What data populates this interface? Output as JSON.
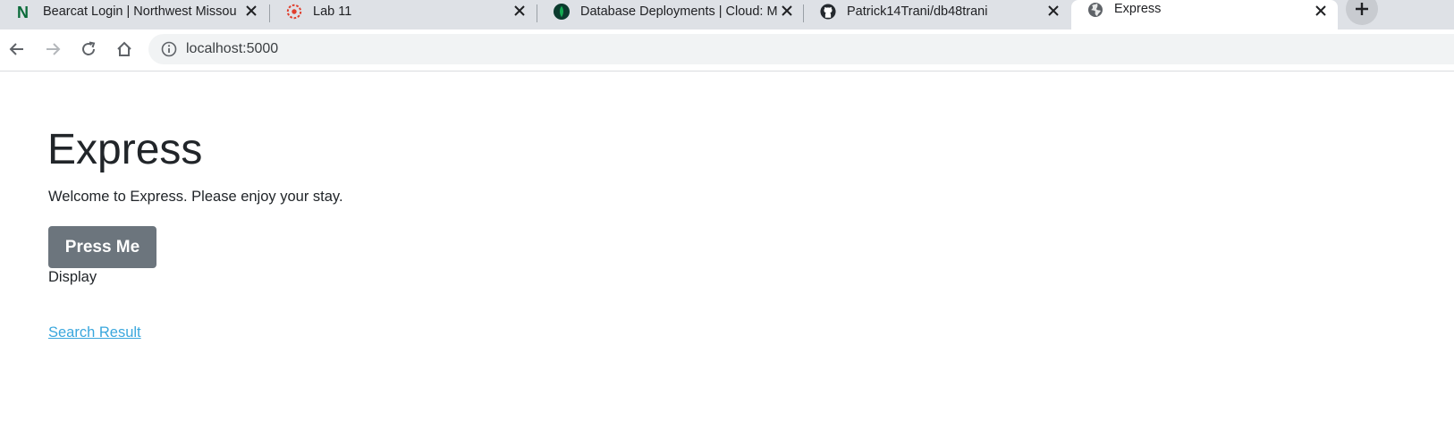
{
  "tabs": [
    {
      "title": "Bearcat Login | Northwest Missou",
      "icon": "northwest-n-icon"
    },
    {
      "title": "Lab 11",
      "icon": "canvas-icon"
    },
    {
      "title": "Database Deployments | Cloud: M",
      "icon": "mongodb-leaf-icon"
    },
    {
      "title": "Patrick14Trani/db48trani",
      "icon": "github-icon"
    },
    {
      "title": "Express",
      "icon": "globe-icon",
      "active": true
    }
  ],
  "address_bar": {
    "url": "localhost:5000"
  },
  "page": {
    "heading": "Express",
    "welcome": "Welcome to Express. Please enjoy your stay.",
    "button_label": "Press Me",
    "display_text": "Display",
    "link_text": "Search Result"
  },
  "colors": {
    "button_bg": "#6c757d",
    "link": "#3aa7dd",
    "text": "#212529",
    "tabstrip": "#dee1e6"
  }
}
